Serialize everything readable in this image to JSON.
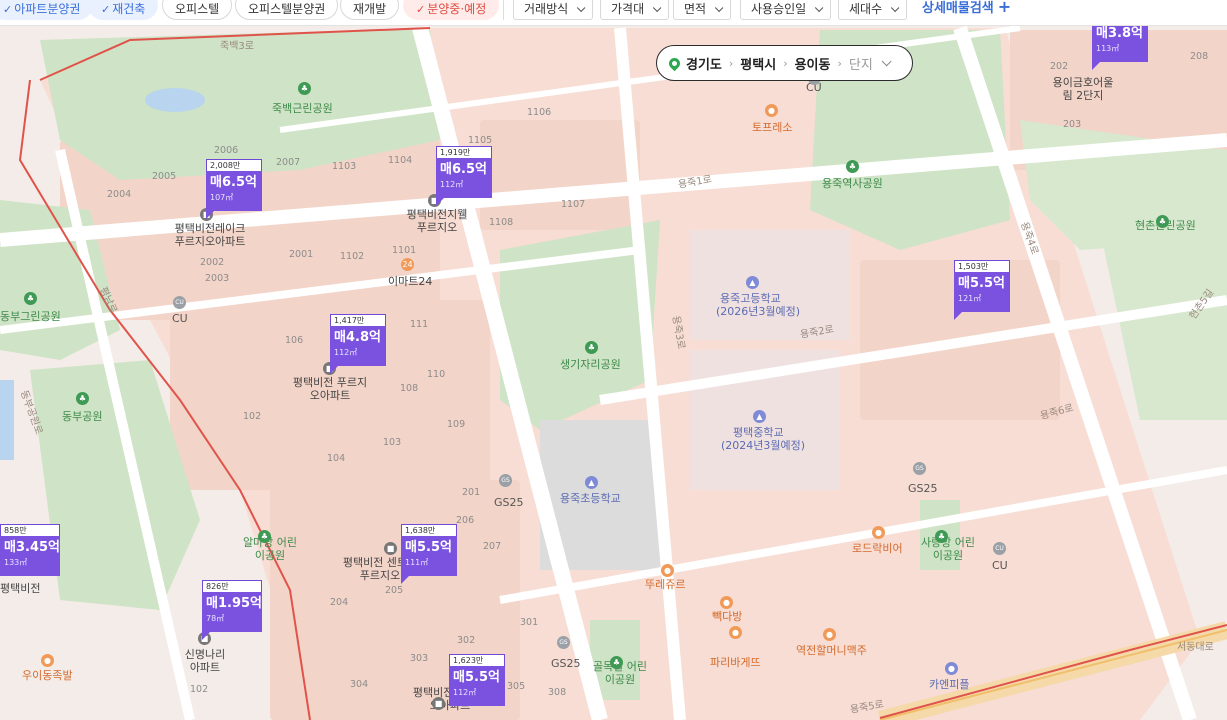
{
  "filters": {
    "chips": [
      {
        "label": "아파트분양권",
        "selected": true
      },
      {
        "label": "재건축",
        "selected": true
      },
      {
        "label": "오피스텔",
        "selected": false
      },
      {
        "label": "오피스텔분양권",
        "selected": false
      },
      {
        "label": "재개발",
        "selected": false
      },
      {
        "label": "분양중·예정",
        "selected": true
      }
    ],
    "dropdowns": [
      "거래방식",
      "가격대",
      "면적",
      "사용승인일",
      "세대수"
    ],
    "detail_search": "상세매물검색",
    "detail_search_icon": "plus-icon"
  },
  "location": {
    "province": "경기도",
    "city": "평택시",
    "district": "용이동",
    "complex": "단지"
  },
  "colors": {
    "marker": "#7b52e0",
    "park": "#3f9a55",
    "boundary": "#e0534a"
  },
  "markers": [
    {
      "unit": "2,008만",
      "price": "매6.5억",
      "area": "107㎡"
    },
    {
      "unit": "1,919만",
      "price": "매6.5억",
      "area": "112㎡"
    },
    {
      "unit": "1,417만",
      "price": "매4.8억",
      "area": "112㎡"
    },
    {
      "unit": "1,503만",
      "price": "매5.5억",
      "area": "121㎡"
    },
    {
      "unit": "1,638만",
      "price": "매5.5억",
      "area": "111㎡"
    },
    {
      "unit": "858만",
      "price": "매3.45억",
      "area": "133㎡"
    },
    {
      "unit": "826만",
      "price": "매1.95억",
      "area": "78㎡"
    },
    {
      "unit": "1,623만",
      "price": "매5.5억",
      "area": "112㎡"
    },
    {
      "unit": "",
      "price": "매3.8억",
      "area": "113㎡"
    }
  ],
  "labels": {
    "roads": [
      "죽백3로",
      "용죽1로",
      "용죽2로",
      "용죽3로",
      "평남로",
      "동부공원로",
      "용죽4로",
      "용죽5로",
      "용죽6로",
      "서동대로",
      "현촌5길"
    ],
    "parks": [
      "죽백근린공원",
      "용죽역사공원",
      "현촌근린공원",
      "동부그린공원",
      "생기자리공원",
      "동부공원",
      "알마당 어린이공원",
      "사랑방 어린이공원",
      "골목길 어린이공원"
    ],
    "schools": [
      "용죽고등학교",
      "(2026년3월예정)",
      "평택중학교",
      "(2024년3월예정)",
      "용죽초등학교"
    ],
    "pois": [
      "토프레소",
      "이마트24",
      "뚜레쥬르",
      "빽다방",
      "파리바게뜨",
      "로드락비어",
      "역전할머니맥주",
      "우이동족발",
      "카엔피플"
    ],
    "stores": [
      "CU",
      "CU",
      "CU",
      "GS25",
      "GS25",
      "GS25"
    ],
    "apartments": [
      "평택비전레이크 푸르지오아파트",
      "평택비전지웰 푸르지오",
      "평택비전 푸르지오아파트",
      "용이금호어울림 2단지",
      "평택비전 센트럴푸르지오",
      "신명나리 아파트",
      "평택비전",
      "평택비전 푸르지오아파트"
    ],
    "blocks": [
      "2006",
      "2005",
      "2007",
      "2004",
      "1103",
      "1104",
      "1105",
      "1106",
      "1107",
      "1108",
      "1101",
      "1102",
      "2001",
      "2002",
      "2003",
      "106",
      "111",
      "110",
      "102",
      "103",
      "104",
      "108",
      "109",
      "201",
      "202",
      "203",
      "204",
      "205",
      "206",
      "207",
      "301",
      "302",
      "303",
      "304",
      "305",
      "308",
      "208",
      "102"
    ]
  }
}
